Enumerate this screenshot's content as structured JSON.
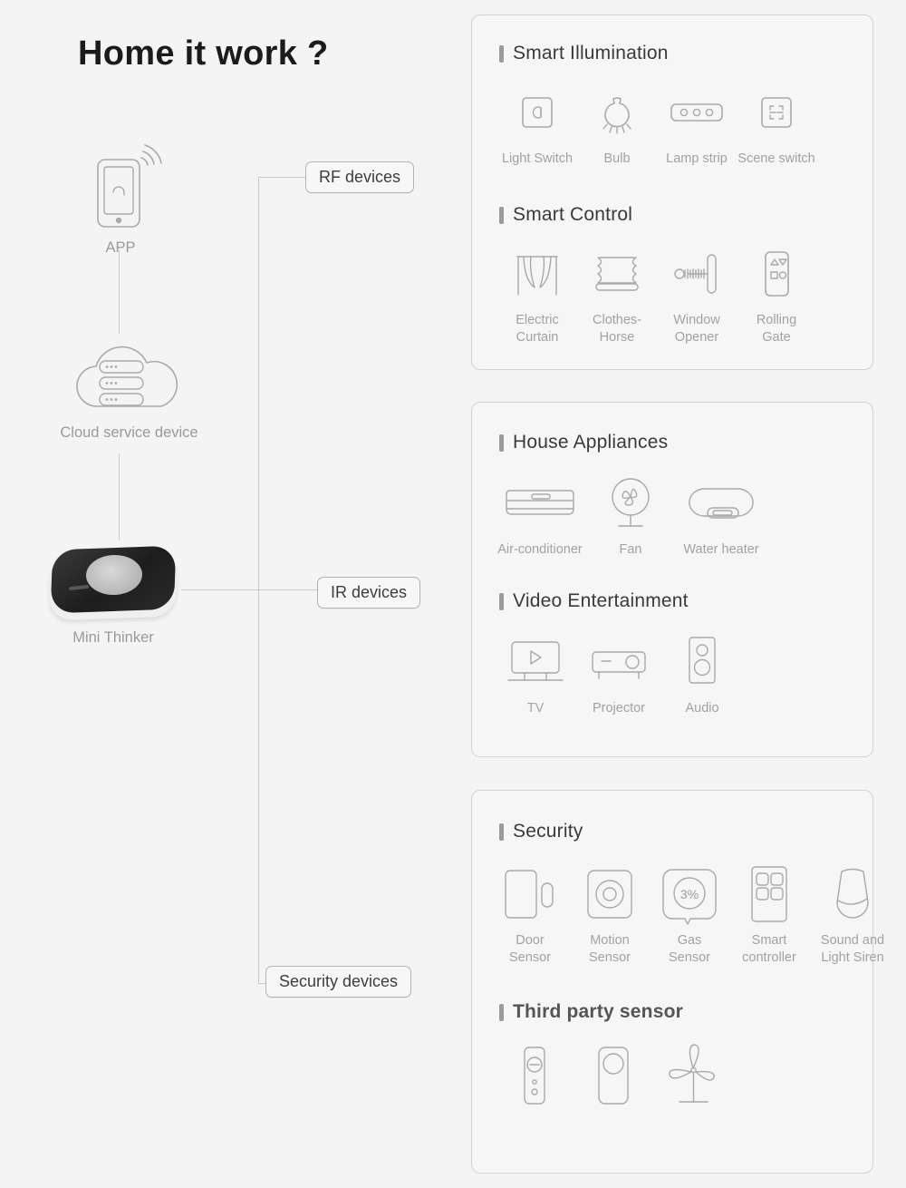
{
  "page": {
    "title": "Home it work ?",
    "background": "#f4f4f4",
    "accent_bar_color": "#9b9b9b",
    "card_border_color": "#d2d2d2",
    "label_color": "#a2a2a2"
  },
  "diagram": {
    "nodes": [
      {
        "id": "app",
        "label": "APP",
        "icon": "smartphone-wifi-icon"
      },
      {
        "id": "cloud",
        "label": "Cloud service device",
        "icon": "cloud-server-icon"
      },
      {
        "id": "hub",
        "label": "Mini Thinker",
        "icon": "mini-thinker-device-image"
      }
    ],
    "chips": [
      {
        "id": "rf",
        "label": "RF devices"
      },
      {
        "id": "ir",
        "label": "IR devices"
      },
      {
        "id": "security",
        "label": "Security devices"
      }
    ]
  },
  "cards": [
    {
      "id": "card-1",
      "sections": [
        {
          "id": "smart-illumination",
          "title": "Smart Illumination",
          "bold": false,
          "items": [
            {
              "label": "Light Switch",
              "icon": "light-switch-icon"
            },
            {
              "label": "Bulb",
              "icon": "bulb-icon"
            },
            {
              "label": "Lamp strip",
              "icon": "lamp-strip-icon"
            },
            {
              "label": "Scene switch",
              "icon": "scene-switch-icon"
            }
          ]
        },
        {
          "id": "smart-control",
          "title": "Smart Control",
          "bold": false,
          "items": [
            {
              "label": "Electric\nCurtain",
              "icon": "electric-curtain-icon"
            },
            {
              "label": "Clothes-\nHorse",
              "icon": "clothes-horse-icon"
            },
            {
              "label": "Window\nOpener",
              "icon": "window-opener-icon"
            },
            {
              "label": "Rolling\nGate",
              "icon": "rolling-gate-icon"
            }
          ]
        }
      ]
    },
    {
      "id": "card-2",
      "sections": [
        {
          "id": "house-appliances",
          "title": "House Appliances",
          "bold": false,
          "items": [
            {
              "label": "Air-conditioner",
              "icon": "air-conditioner-icon"
            },
            {
              "label": "Fan",
              "icon": "fan-icon"
            },
            {
              "label": "Water heater",
              "icon": "water-heater-icon"
            }
          ]
        },
        {
          "id": "video-entertainment",
          "title": "Video Entertainment",
          "bold": false,
          "items": [
            {
              "label": "TV",
              "icon": "tv-icon"
            },
            {
              "label": "Projector",
              "icon": "projector-icon"
            },
            {
              "label": "Audio",
              "icon": "audio-speaker-icon"
            }
          ]
        }
      ]
    },
    {
      "id": "card-3",
      "sections": [
        {
          "id": "security",
          "title": "Security",
          "bold": false,
          "items": [
            {
              "label": "Door\nSensor",
              "icon": "door-sensor-icon"
            },
            {
              "label": "Motion\nSensor",
              "icon": "motion-sensor-icon"
            },
            {
              "label": "Gas\nSensor",
              "icon": "gas-sensor-icon",
              "badge": "3%"
            },
            {
              "label": "Smart\ncontroller",
              "icon": "smart-controller-icon"
            },
            {
              "label": "Sound and\nLight Siren",
              "icon": "sound-light-siren-icon"
            }
          ]
        },
        {
          "id": "third-party-sensor",
          "title": "Third party sensor",
          "bold": true,
          "items": [
            {
              "label": "",
              "icon": "remote-sensor-icon"
            },
            {
              "label": "",
              "icon": "round-button-sensor-icon"
            },
            {
              "label": "",
              "icon": "plant-sensor-icon"
            }
          ]
        }
      ]
    }
  ]
}
